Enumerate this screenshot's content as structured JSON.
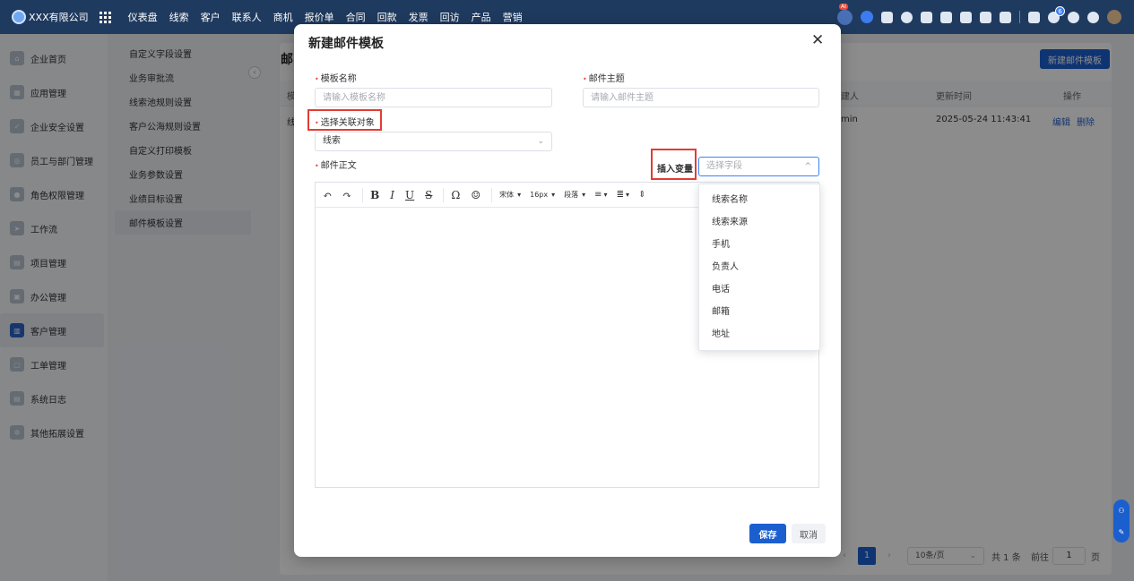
{
  "topbar": {
    "company": "XXX有限公司",
    "nav": [
      "仪表盘",
      "线索",
      "客户",
      "联系人",
      "商机",
      "报价单",
      "合同",
      "回款",
      "发票",
      "回访",
      "产品",
      "营销"
    ],
    "ai_badge": "AI",
    "notif_count": "6"
  },
  "sidebar": {
    "items": [
      {
        "label": "企业首页",
        "icon": "home-icon"
      },
      {
        "label": "应用管理",
        "icon": "apps-icon"
      },
      {
        "label": "企业安全设置",
        "icon": "shield-icon"
      },
      {
        "label": "员工与部门管理",
        "icon": "team-icon"
      },
      {
        "label": "角色权限管理",
        "icon": "user-icon"
      },
      {
        "label": "工作流",
        "icon": "workflow-icon"
      },
      {
        "label": "项目管理",
        "icon": "project-icon"
      },
      {
        "label": "办公管理",
        "icon": "office-icon"
      },
      {
        "label": "客户管理",
        "icon": "customer-icon"
      },
      {
        "label": "工单管理",
        "icon": "ticket-icon"
      },
      {
        "label": "系统日志",
        "icon": "log-icon"
      },
      {
        "label": "其他拓展设置",
        "icon": "gear-icon"
      }
    ]
  },
  "subnav": {
    "items": [
      "自定义字段设置",
      "业务审批流",
      "线索池规则设置",
      "客户公海规则设置",
      "自定义打印模板",
      "业务参数设置",
      "业绩目标设置",
      "邮件模板设置"
    ]
  },
  "main": {
    "title": "邮",
    "new_button": "新建邮件模板",
    "columns": {
      "col1": "模",
      "creator": "建人",
      "updated": "更新时间",
      "ops": "操作"
    },
    "row": {
      "col1": "线",
      "creator": "min",
      "updated": "2025-05-24 11:43:41",
      "edit": "编辑",
      "delete": "删除"
    },
    "pager": {
      "current": "1",
      "page_size": "10条/页",
      "total": "共 1 条",
      "goto": "前往",
      "goto_value": "1",
      "page_unit": "页"
    }
  },
  "dialog": {
    "title": "新建邮件模板",
    "name_label": "模板名称",
    "name_placeholder": "请输入模板名称",
    "subject_label": "邮件主题",
    "subject_placeholder": "请输入邮件主题",
    "object_label": "选择关联对象",
    "object_value": "线索",
    "body_label": "邮件正文",
    "insert_label": "插入变量",
    "field_placeholder": "选择字段",
    "toolbar": {
      "font": "宋体",
      "size": "16px",
      "para": "段落"
    },
    "save": "保存",
    "cancel": "取消"
  },
  "dropdown": {
    "options": [
      "线索名称",
      "线索来源",
      "手机",
      "负责人",
      "电话",
      "邮箱",
      "地址"
    ]
  },
  "colors": {
    "primary": "#1b5fcf",
    "topbar": "#1f3a5f",
    "highlight": "#e23c32"
  }
}
